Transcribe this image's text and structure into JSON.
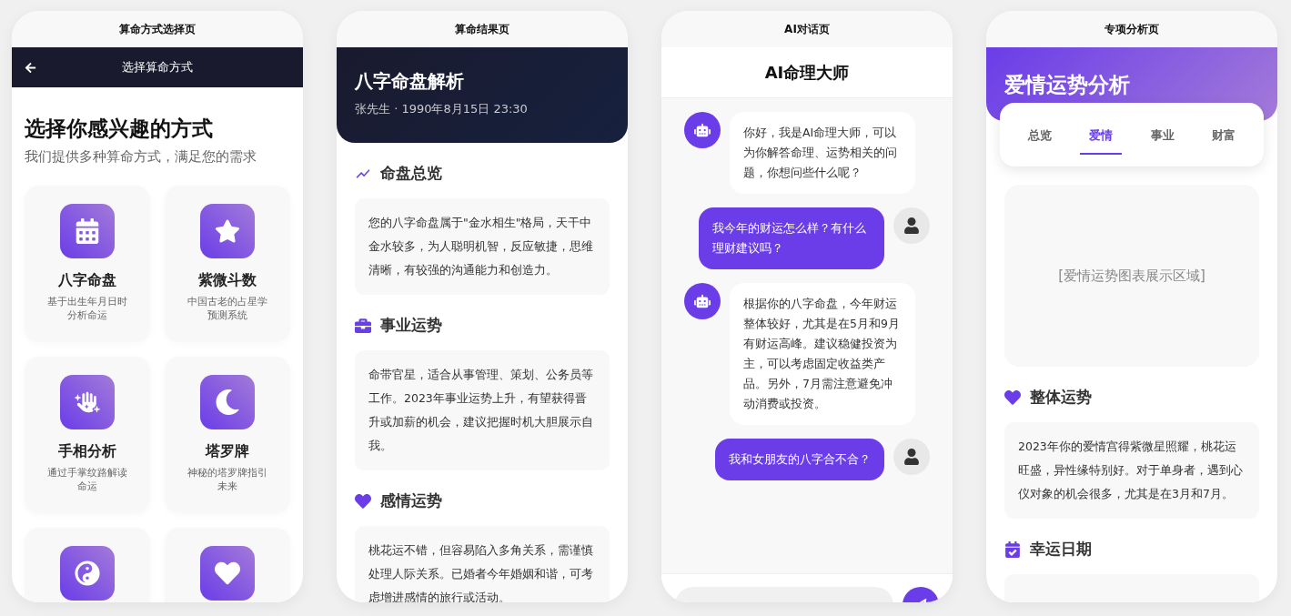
{
  "screens": [
    {
      "kind": "methods",
      "label": "算命方式选择页",
      "nav_title": "选择算命方式",
      "heading": "选择你感兴趣的方式",
      "subheading": "我们提供多种算命方式，满足您的需求",
      "methods": [
        {
          "kind": "full",
          "title": "八字命盘",
          "desc": "基于出生年月日时分析命运"
        },
        {
          "kind": "full",
          "title": "紫微斗数",
          "desc": "中国古老的占星学预测系统"
        },
        {
          "kind": "full",
          "title": "手相分析",
          "desc": "通过手掌纹路解读命运"
        },
        {
          "kind": "full",
          "title": "塔罗牌",
          "desc": "神秘的塔罗牌指引未来"
        },
        {
          "kind": "cut"
        },
        {
          "kind": "cut"
        }
      ]
    },
    {
      "kind": "result",
      "label": "算命结果页",
      "title": "八字命盘解析",
      "subtitle": "张先生 · 1990年8月15日 23:30",
      "sections": [
        {
          "title": "命盘总览",
          "text": "您的八字命盘属于\"金水相生\"格局，天干中金水较多，为人聪明机智，反应敏捷，思维清晰，有较强的沟通能力和创造力。"
        },
        {
          "title": "事业运势",
          "text": "命带官星，适合从事管理、策划、公务员等工作。2023年事业运势上升，有望获得晋升或加薪的机会，建议把握时机大胆展示自我。"
        },
        {
          "title": "感情运势",
          "text": "桃花运不错，但容易陷入多角关系，需谨慎处理人际关系。已婚者今年婚姻和谐，可考虑增进感情的旅行或活动。"
        }
      ]
    },
    {
      "kind": "chat",
      "label": "AI对话页",
      "title": "AI命理大师",
      "messages": [
        {
          "kind": "bot",
          "text": "你好，我是AI命理大师，可以为你解答命理、运势相关的问题，你想问些什么呢？"
        },
        {
          "kind": "user",
          "text": "我今年的财运怎么样？有什么理财建议吗？"
        },
        {
          "kind": "bot",
          "text": "根据你的八字命盘，今年财运整体较好，尤其是在5月和9月有财运高峰。建议稳健投资为主，可以考虑固定收益类产品。另外，7月需注意避免冲动消费或投资。"
        },
        {
          "kind": "user",
          "text": "我和女朋友的八字合不合？"
        }
      ]
    },
    {
      "kind": "analysis",
      "label": "专项分析页",
      "title": "爱情运势分析",
      "tabs": [
        {
          "label": "总览",
          "selected": false
        },
        {
          "label": "爱情",
          "selected": true
        },
        {
          "label": "事业",
          "selected": false
        },
        {
          "label": "财富",
          "selected": false
        }
      ],
      "chart_placeholder": "[爱情运势图表展示区域]",
      "sections": [
        {
          "title": "整体运势",
          "text": "2023年你的爱情宫得紫微星照耀，桃花运旺盛，异性缘特别好。对于单身者，遇到心仪对象的机会很多，尤其是在3月和7月。"
        },
        {
          "title": "幸运日期"
        }
      ]
    }
  ]
}
